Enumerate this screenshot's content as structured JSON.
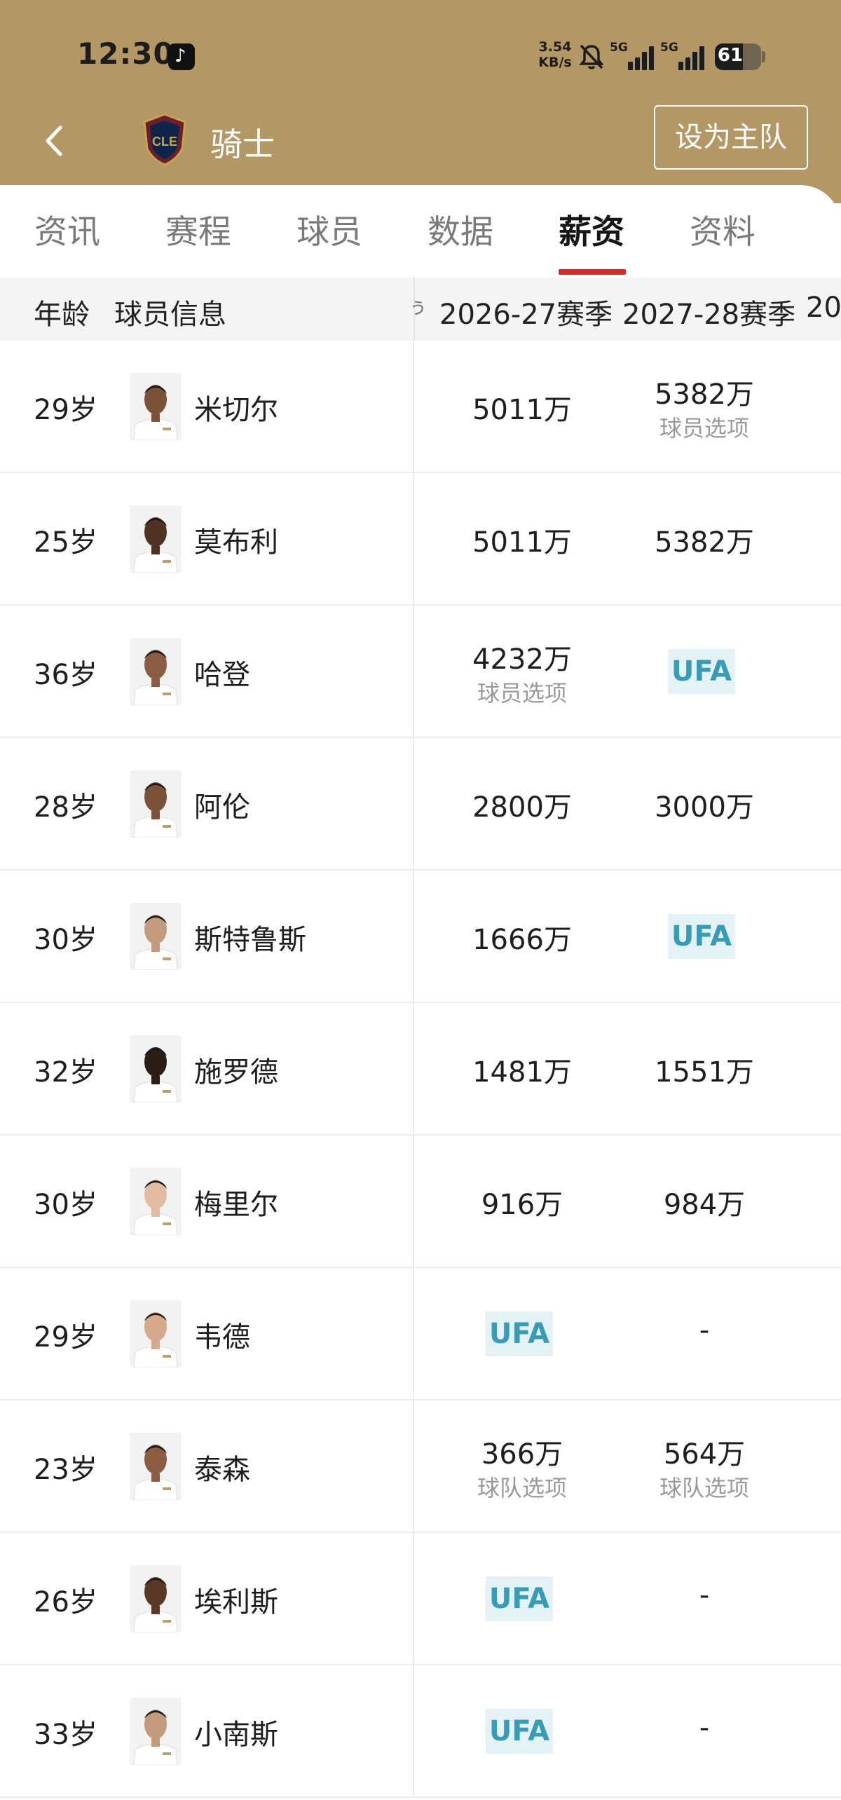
{
  "status_bar": {
    "time": "12:30",
    "net_speed_value": "3.54",
    "net_speed_unit": "KB/s",
    "signal_1": "5G",
    "signal_2": "5G",
    "battery_level": "61",
    "battery_fraction": 0.61
  },
  "nav": {
    "team_name": "骑士",
    "set_home_label": "设为主队",
    "team_logo_text": "CLE"
  },
  "tabs": [
    {
      "label": "资讯"
    },
    {
      "label": "赛程"
    },
    {
      "label": "球员"
    },
    {
      "label": "数据"
    },
    {
      "label": "薪资"
    },
    {
      "label": "资料"
    }
  ],
  "active_tab": "薪资",
  "table": {
    "headers": {
      "age": "年龄",
      "player": "球员信息",
      "partial_left": "ぅ",
      "season1": "2026-27赛季",
      "season2": "2027-28赛季",
      "partial_right": "20"
    },
    "rows": [
      {
        "age": "29岁",
        "name": "米切尔",
        "s1": "5011万",
        "s1_note": "",
        "s2": "5382万",
        "s2_note": "球员选项"
      },
      {
        "age": "25岁",
        "name": "莫布利",
        "s1": "5011万",
        "s1_note": "",
        "s2": "5382万",
        "s2_note": ""
      },
      {
        "age": "36岁",
        "name": "哈登",
        "s1": "4232万",
        "s1_note": "球员选项",
        "s2": "UFA",
        "s2_note": ""
      },
      {
        "age": "28岁",
        "name": "阿伦",
        "s1": "2800万",
        "s1_note": "",
        "s2": "3000万",
        "s2_note": ""
      },
      {
        "age": "30岁",
        "name": "斯特鲁斯",
        "s1": "1666万",
        "s1_note": "",
        "s2": "UFA",
        "s2_note": ""
      },
      {
        "age": "32岁",
        "name": "施罗德",
        "s1": "1481万",
        "s1_note": "",
        "s2": "1551万",
        "s2_note": ""
      },
      {
        "age": "30岁",
        "name": "梅里尔",
        "s1": "916万",
        "s1_note": "",
        "s2": "984万",
        "s2_note": ""
      },
      {
        "age": "29岁",
        "name": "韦德",
        "s1": "UFA",
        "s1_note": "",
        "s2": "-",
        "s2_note": ""
      },
      {
        "age": "23岁",
        "name": "泰森",
        "s1": "366万",
        "s1_note": "球队选项",
        "s2": "564万",
        "s2_note": "球队选项"
      },
      {
        "age": "26岁",
        "name": "埃利斯",
        "s1": "UFA",
        "s1_note": "",
        "s2": "-",
        "s2_note": ""
      },
      {
        "age": "33岁",
        "name": "小南斯",
        "s1": "UFA",
        "s1_note": "",
        "s2": "-",
        "s2_note": ""
      }
    ]
  },
  "colors": {
    "header_bg": "#b39765",
    "tab_indicator": "#d22c2c",
    "ufa_bg": "#e4f2f6",
    "ufa_text": "#3a9bb5"
  },
  "avatar_skin_tones": [
    "#7a5238",
    "#4f3222",
    "#8a5d42",
    "#7a5238",
    "#c39a7c",
    "#2b1c14",
    "#e2bca2",
    "#d7a98c",
    "#8a5d42",
    "#5a3826",
    "#c39a7c"
  ]
}
